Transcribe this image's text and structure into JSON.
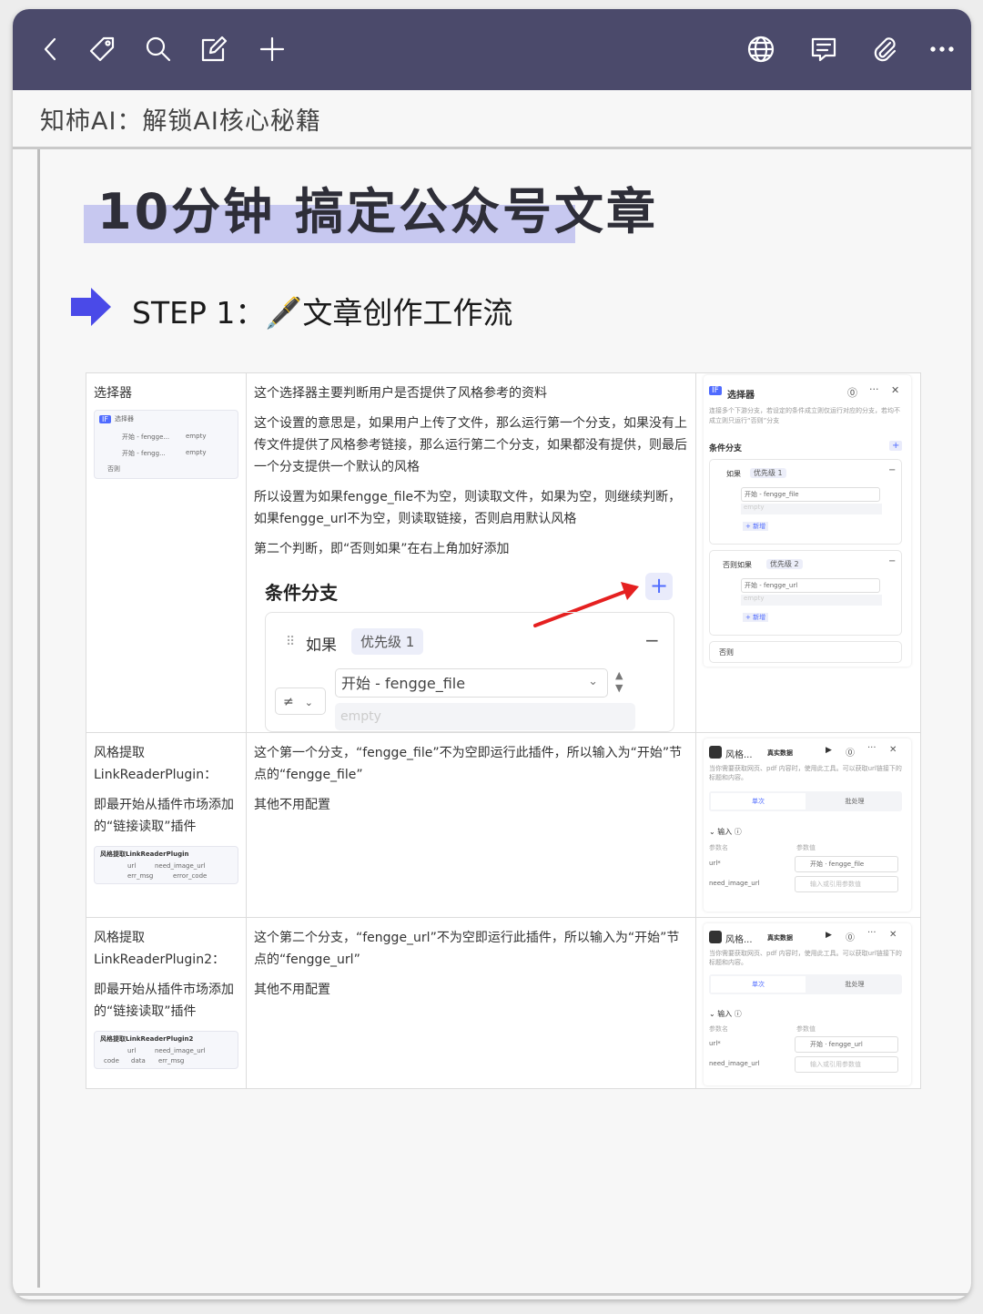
{
  "toolbar": {
    "icons": [
      "back-icon",
      "tag-icon",
      "search-icon",
      "edit-icon",
      "plus-icon",
      "globe-icon",
      "comment-icon",
      "attachment-icon",
      "more-icon"
    ]
  },
  "note": {
    "title": "知柿AI：解锁AI核心秘籍"
  },
  "doc": {
    "title": "10分钟 搞定公众号文章",
    "step": "STEP 1：🖋️文章创作工作流"
  },
  "rows": [
    {
      "name": "选择器",
      "desc": [
        "这个选择器主要判断用户是否提供了风格参考的资料",
        "这个设置的意思是，如果用户上传了文件，那么运行第一个分支，如果没有上传文件提供了风格参考链接，那么运行第二个分支，如果都没有提供，则最后一个分支提供一个默认的风格",
        "所以设置为如果fengge_file不为空，则读取文件，如果为空，则继续判断，如果fengge_url不为空，则读取链接，否则启用默认风格",
        "第二个判断，即“否则如果”在右上角加好添加"
      ],
      "zoom": {
        "heading": "条件分支",
        "if_label": "如果",
        "priority": "优先级 1",
        "op": "≠",
        "field": "开始 - fengge_file",
        "empty": "empty"
      },
      "thumb": {
        "title": "选择器",
        "r1": "开始 - fengge...",
        "r2": "empty",
        "r3": "开始 - fengg...",
        "r4": "empty",
        "r5": "否则"
      },
      "panel": {
        "title": "选择器",
        "desc": "连接多个下游分支，若设定的条件成立则仅运行对应的分支，若均不成立则只运行“否则”分支",
        "section": "条件分支",
        "b1": "如果",
        "p1": "优先级 1",
        "f1": "开始 - fengge_file",
        "e1": "empty",
        "add1": "+ 新增",
        "b2": "否则如果",
        "p2": "优先级 2",
        "f2": "开始 - fengge_url",
        "e2": "empty",
        "add2": "+ 新增",
        "b3": "否则"
      }
    },
    {
      "name": "风格提取LinkReaderPlugin：",
      "note": "即最开始从插件市场添加的“链接读取”插件",
      "desc": [
        "这个第一个分支，“fengge_file”不为空即运行此插件，所以输入为“开始”节点的“fengge_file”",
        "其他不用配置"
      ],
      "thumb": {
        "title": "风格提取LinkReaderPlugin",
        "a": "url",
        "b": "need_image_url",
        "c": "err_msg",
        "d": "error_code"
      },
      "panel": {
        "title": "风格...",
        "tag": "真实数据",
        "desc": "当你需要获取网页、pdf 内容时，使用此工具。可以获取url链接下的标题和内容。",
        "tab1": "单次",
        "tab2": "批处理",
        "section": "输入",
        "k": "参数名",
        "v": "参数值",
        "p1": "url*",
        "v1": "开始 · fengge_file",
        "p2": "need_image_url",
        "v2": "输入或引用参数值"
      }
    },
    {
      "name": "风格提取LinkReaderPlugin2：",
      "note": "即最开始从插件市场添加的“链接读取”插件",
      "desc": [
        "这个第二个分支，“fengge_url”不为空即运行此插件，所以输入为“开始”节点的“fengge_url”",
        "其他不用配置"
      ],
      "thumb": {
        "title": "风格提取LinkReaderPlugin2",
        "a": "url",
        "b": "need_image_url",
        "c": "code",
        "d": "data",
        "e": "err_msg"
      },
      "panel": {
        "title": "风格...",
        "tag": "真实数据",
        "desc": "当你需要获取网页、pdf 内容时，使用此工具。可以获取url链接下的标题和内容。",
        "tab1": "单次",
        "tab2": "批处理",
        "section": "输入",
        "k": "参数名",
        "v": "参数值",
        "p1": "url*",
        "v1": "开始 · fengge_url",
        "p2": "need_image_url",
        "v2": "输入或引用参数值"
      }
    }
  ],
  "colors": {
    "toolbar": "#4b4a6b",
    "highlight": "#c7c8f0",
    "arrow": "#4a4ae8",
    "red_arrow": "#e52020",
    "accent": "#4f6bff"
  }
}
